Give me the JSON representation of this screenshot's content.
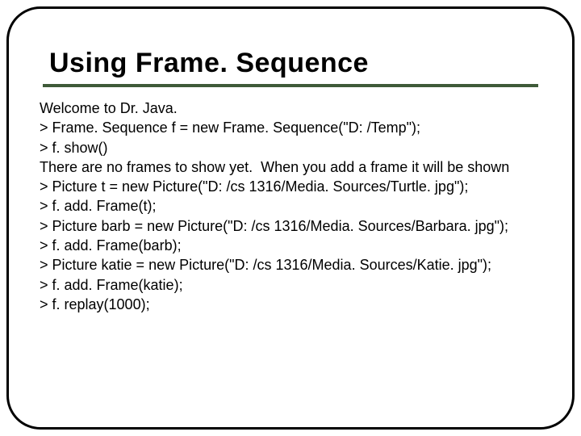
{
  "title": "Using Frame. Sequence",
  "lines": [
    "Welcome to Dr. Java.",
    "> Frame. Sequence f = new Frame. Sequence(\"D: /Temp\");",
    "> f. show()",
    "There are no frames to show yet.  When you add a frame it will be shown",
    "> Picture t = new Picture(\"D: /cs 1316/Media. Sources/Turtle. jpg\");",
    "> f. add. Frame(t);",
    "> Picture barb = new Picture(\"D: /cs 1316/Media. Sources/Barbara. jpg\");",
    "> f. add. Frame(barb);",
    "> Picture katie = new Picture(\"D: /cs 1316/Media. Sources/Katie. jpg\");",
    "> f. add. Frame(katie);",
    "> f. replay(1000);"
  ]
}
